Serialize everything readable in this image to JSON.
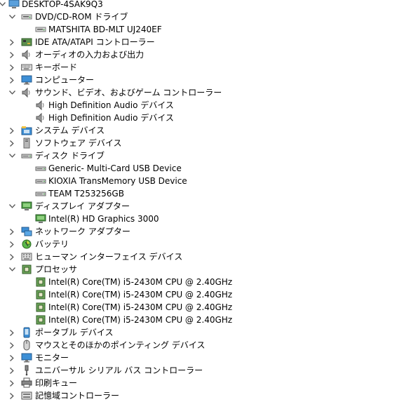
{
  "root": {
    "label": "DESKTOP-4SAK9Q3",
    "icon": "computer-icon"
  },
  "items": [
    {
      "label": "DVD/CD-ROM ドライブ",
      "level": 1,
      "state": "expanded",
      "icon": "dvd-drive-icon"
    },
    {
      "label": "MATSHITA BD-MLT UJ240EF",
      "level": 2,
      "state": "leaf",
      "icon": "dvd-drive-icon"
    },
    {
      "label": "IDE ATA/ATAPI コントローラー",
      "level": 1,
      "state": "collapsed",
      "icon": "ide-controller-icon"
    },
    {
      "label": "オーディオの入力および出力",
      "level": 1,
      "state": "collapsed",
      "icon": "speaker-icon"
    },
    {
      "label": "キーボード",
      "level": 1,
      "state": "collapsed",
      "icon": "keyboard-icon"
    },
    {
      "label": "コンピューター",
      "level": 1,
      "state": "collapsed",
      "icon": "monitor-icon"
    },
    {
      "label": "サウンド、ビデオ、およびゲーム コントローラー",
      "level": 1,
      "state": "expanded",
      "icon": "speaker-icon"
    },
    {
      "label": "High Definition Audio デバイス",
      "level": 2,
      "state": "leaf",
      "icon": "speaker-icon"
    },
    {
      "label": "High Definition Audio デバイス",
      "level": 2,
      "state": "leaf",
      "icon": "speaker-icon"
    },
    {
      "label": "システム デバイス",
      "level": 1,
      "state": "collapsed",
      "icon": "system-folder-icon"
    },
    {
      "label": "ソフトウェア デバイス",
      "level": 1,
      "state": "collapsed",
      "icon": "software-device-icon"
    },
    {
      "label": "ディスク ドライブ",
      "level": 1,
      "state": "expanded",
      "icon": "disk-drive-icon"
    },
    {
      "label": "Generic- Multi-Card USB Device",
      "level": 2,
      "state": "leaf",
      "icon": "disk-drive-icon"
    },
    {
      "label": "KIOXIA TransMemory USB Device",
      "level": 2,
      "state": "leaf",
      "icon": "disk-drive-icon"
    },
    {
      "label": "TEAM T253256GB",
      "level": 2,
      "state": "leaf",
      "icon": "disk-drive-icon"
    },
    {
      "label": "ディスプレイ アダプター",
      "level": 1,
      "state": "expanded",
      "icon": "display-adapter-icon"
    },
    {
      "label": "Intel(R) HD Graphics 3000",
      "level": 2,
      "state": "leaf",
      "icon": "display-adapter-icon"
    },
    {
      "label": "ネットワーク アダプター",
      "level": 1,
      "state": "collapsed",
      "icon": "network-icon"
    },
    {
      "label": "バッテリ",
      "level": 1,
      "state": "collapsed",
      "icon": "battery-icon"
    },
    {
      "label": "ヒューマン インターフェイス デバイス",
      "level": 1,
      "state": "collapsed",
      "icon": "hid-icon"
    },
    {
      "label": "プロセッサ",
      "level": 1,
      "state": "expanded",
      "icon": "processor-icon"
    },
    {
      "label": "Intel(R) Core(TM) i5-2430M CPU @ 2.40GHz",
      "level": 2,
      "state": "leaf",
      "icon": "processor-icon"
    },
    {
      "label": "Intel(R) Core(TM) i5-2430M CPU @ 2.40GHz",
      "level": 2,
      "state": "leaf",
      "icon": "processor-icon"
    },
    {
      "label": "Intel(R) Core(TM) i5-2430M CPU @ 2.40GHz",
      "level": 2,
      "state": "leaf",
      "icon": "processor-icon"
    },
    {
      "label": "Intel(R) Core(TM) i5-2430M CPU @ 2.40GHz",
      "level": 2,
      "state": "leaf",
      "icon": "processor-icon"
    },
    {
      "label": "ポータブル デバイス",
      "level": 1,
      "state": "collapsed",
      "icon": "portable-device-icon"
    },
    {
      "label": "マウスとそのほかのポインティング デバイス",
      "level": 1,
      "state": "collapsed",
      "icon": "mouse-icon"
    },
    {
      "label": "モニター",
      "level": 1,
      "state": "collapsed",
      "icon": "monitor-icon"
    },
    {
      "label": "ユニバーサル シリアル バス コントローラー",
      "level": 1,
      "state": "collapsed",
      "icon": "usb-icon"
    },
    {
      "label": "印刷キュー",
      "level": 1,
      "state": "collapsed",
      "icon": "printer-icon"
    },
    {
      "label": "記憶域コントローラー",
      "level": 1,
      "state": "collapsed",
      "icon": "storage-controller-icon"
    }
  ]
}
